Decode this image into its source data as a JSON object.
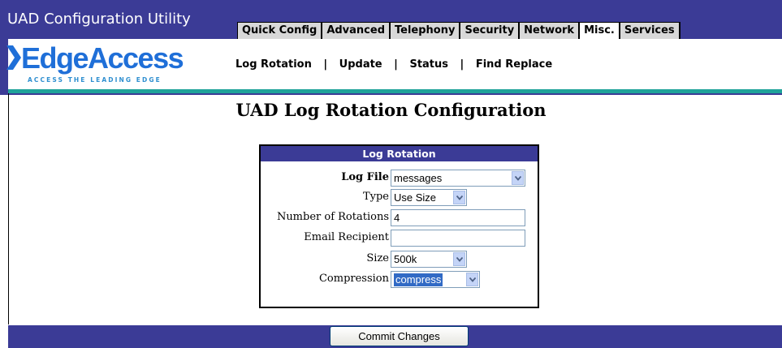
{
  "app": {
    "title": "UAD Configuration Utility"
  },
  "logo": {
    "name": "EdgeAccess",
    "tagline": "ACCESS THE LEADING EDGE"
  },
  "tabs": [
    {
      "label": "Quick Config",
      "active": false
    },
    {
      "label": "Advanced",
      "active": false
    },
    {
      "label": "Telephony",
      "active": false
    },
    {
      "label": "Security",
      "active": false
    },
    {
      "label": "Network",
      "active": false
    },
    {
      "label": "Misc.",
      "active": true
    },
    {
      "label": "Services",
      "active": false
    }
  ],
  "subnav": {
    "items": [
      "Log Rotation",
      "Update",
      "Status",
      "Find Replace"
    ],
    "separator": "|"
  },
  "page": {
    "title": "UAD Log Rotation Configuration"
  },
  "panel": {
    "heading": "Log Rotation",
    "fields": {
      "log_file": {
        "label": "Log File",
        "value": "messages"
      },
      "type": {
        "label": "Type",
        "value": "Use Size"
      },
      "rotations": {
        "label": "Number of Rotations",
        "value": "4"
      },
      "email": {
        "label": "Email Recipient",
        "value": ""
      },
      "size": {
        "label": "Size",
        "value": "500k"
      },
      "compression": {
        "label": "Compression",
        "value": "compress"
      }
    }
  },
  "footer": {
    "commit_label": "Commit Changes"
  },
  "colors": {
    "header_bg": "#3b3b96",
    "accent_line": "#1fa39a",
    "logo_blue": "#1f6fd8",
    "selection": "#316ac5"
  }
}
